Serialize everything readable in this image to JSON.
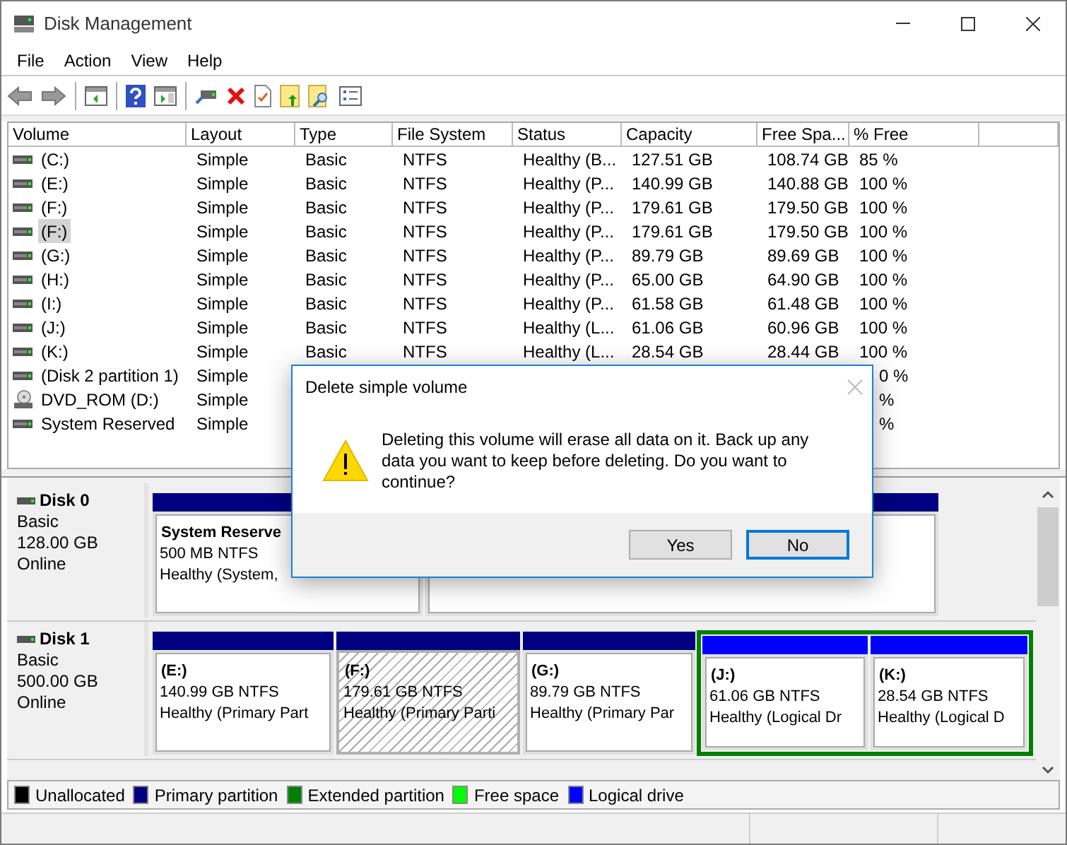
{
  "window": {
    "title": "Disk Management"
  },
  "menu": [
    "File",
    "Action",
    "View",
    "Help"
  ],
  "table": {
    "columns": [
      "Volume",
      "Layout",
      "Type",
      "File System",
      "Status",
      "Capacity",
      "Free Spa...",
      "% Free"
    ],
    "rows": [
      {
        "kind": "disk",
        "volume": "(C:)",
        "layout": "Simple",
        "type": "Basic",
        "file_system": "NTFS",
        "status": "Healthy (B...",
        "capacity": "127.51 GB",
        "free_space": "108.74 GB",
        "pct_free": "85 %",
        "selected": false
      },
      {
        "kind": "disk",
        "volume": "(E:)",
        "layout": "Simple",
        "type": "Basic",
        "file_system": "NTFS",
        "status": "Healthy (P...",
        "capacity": "140.99 GB",
        "free_space": "140.88 GB",
        "pct_free": "100 %",
        "selected": false
      },
      {
        "kind": "disk",
        "volume": "(F:)",
        "layout": "Simple",
        "type": "Basic",
        "file_system": "NTFS",
        "status": "Healthy (P...",
        "capacity": "179.61 GB",
        "free_space": "179.50 GB",
        "pct_free": "100 %",
        "selected": false
      },
      {
        "kind": "disk",
        "volume": "(F:)",
        "layout": "Simple",
        "type": "Basic",
        "file_system": "NTFS",
        "status": "Healthy (P...",
        "capacity": "179.61 GB",
        "free_space": "179.50 GB",
        "pct_free": "100 %",
        "selected": true
      },
      {
        "kind": "disk",
        "volume": "(G:)",
        "layout": "Simple",
        "type": "Basic",
        "file_system": "NTFS",
        "status": "Healthy (P...",
        "capacity": "89.79 GB",
        "free_space": "89.69 GB",
        "pct_free": "100 %",
        "selected": false
      },
      {
        "kind": "disk",
        "volume": "(H:)",
        "layout": "Simple",
        "type": "Basic",
        "file_system": "NTFS",
        "status": "Healthy (P...",
        "capacity": "65.00 GB",
        "free_space": "64.90 GB",
        "pct_free": "100 %",
        "selected": false
      },
      {
        "kind": "disk",
        "volume": "(I:)",
        "layout": "Simple",
        "type": "Basic",
        "file_system": "NTFS",
        "status": "Healthy (P...",
        "capacity": "61.58 GB",
        "free_space": "61.48 GB",
        "pct_free": "100 %",
        "selected": false
      },
      {
        "kind": "disk",
        "volume": "(J:)",
        "layout": "Simple",
        "type": "Basic",
        "file_system": "NTFS",
        "status": "Healthy (L...",
        "capacity": "61.06 GB",
        "free_space": "60.96 GB",
        "pct_free": "100 %",
        "selected": false
      },
      {
        "kind": "disk",
        "volume": "(K:)",
        "layout": "Simple",
        "type": "Basic",
        "file_system": "NTFS",
        "status": "Healthy (L...",
        "capacity": "28.54 GB",
        "free_space": "28.44 GB",
        "pct_free": "100 %",
        "selected": false
      },
      {
        "kind": "disk",
        "volume": "(Disk 2 partition 1)",
        "layout": "Simple",
        "pct_free": "0 %",
        "selected": false
      },
      {
        "kind": "dvd",
        "volume": "DVD_ROM (D:)",
        "layout": "Simple",
        "pct_free": "%",
        "selected": false
      },
      {
        "kind": "disk",
        "volume": "System Reserved",
        "layout": "Simple",
        "pct_free": "%",
        "selected": false
      }
    ]
  },
  "disks": [
    {
      "name": "Disk 0",
      "type": "Basic",
      "size": "128.00 GB",
      "status": "Online",
      "partitions": [
        {
          "color": "#000080",
          "label": "System Reserve",
          "size": "500 MB NTFS",
          "status": "Healthy (System,",
          "selected": false
        },
        {
          "color": "#000080",
          "selected": false
        }
      ]
    },
    {
      "name": "Disk 1",
      "type": "Basic",
      "size": "500.00 GB",
      "status": "Online",
      "partitions": [
        {
          "color": "#000080",
          "label": "(E:)",
          "size": "140.99 GB NTFS",
          "status": "Healthy (Primary Part",
          "selected": false
        },
        {
          "color": "#000080",
          "label": "(F:)",
          "size": "179.61 GB NTFS",
          "status": "Healthy (Primary Parti",
          "selected": true
        },
        {
          "color": "#000080",
          "label": "(G:)",
          "size": "89.79 GB NTFS",
          "status": "Healthy (Primary Par",
          "selected": false
        },
        {
          "color": "#008000",
          "children": [
            {
              "color": "#0000ff",
              "label": "(J:)",
              "size": "61.06 GB NTFS",
              "status": "Healthy (Logical Dr",
              "selected": false
            },
            {
              "color": "#0000ff",
              "label": "(K:)",
              "size": "28.54 GB NTFS",
              "status": "Healthy (Logical D",
              "selected": false
            }
          ]
        }
      ]
    }
  ],
  "legend": [
    {
      "label": "Unallocated",
      "color": "#000000"
    },
    {
      "label": "Primary partition",
      "color": "#000080"
    },
    {
      "label": "Extended partition",
      "color": "#008000"
    },
    {
      "label": "Free space",
      "color": "#00ff00"
    },
    {
      "label": "Logical drive",
      "color": "#0000ff"
    }
  ],
  "dialog": {
    "title": "Delete simple volume",
    "message": "Deleting this volume will erase all data on it. Back up any data you want to keep before deleting. Do you want to continue?",
    "buttons": [
      {
        "label": "Yes",
        "selected": false
      },
      {
        "label": "No",
        "selected": true
      }
    ]
  }
}
